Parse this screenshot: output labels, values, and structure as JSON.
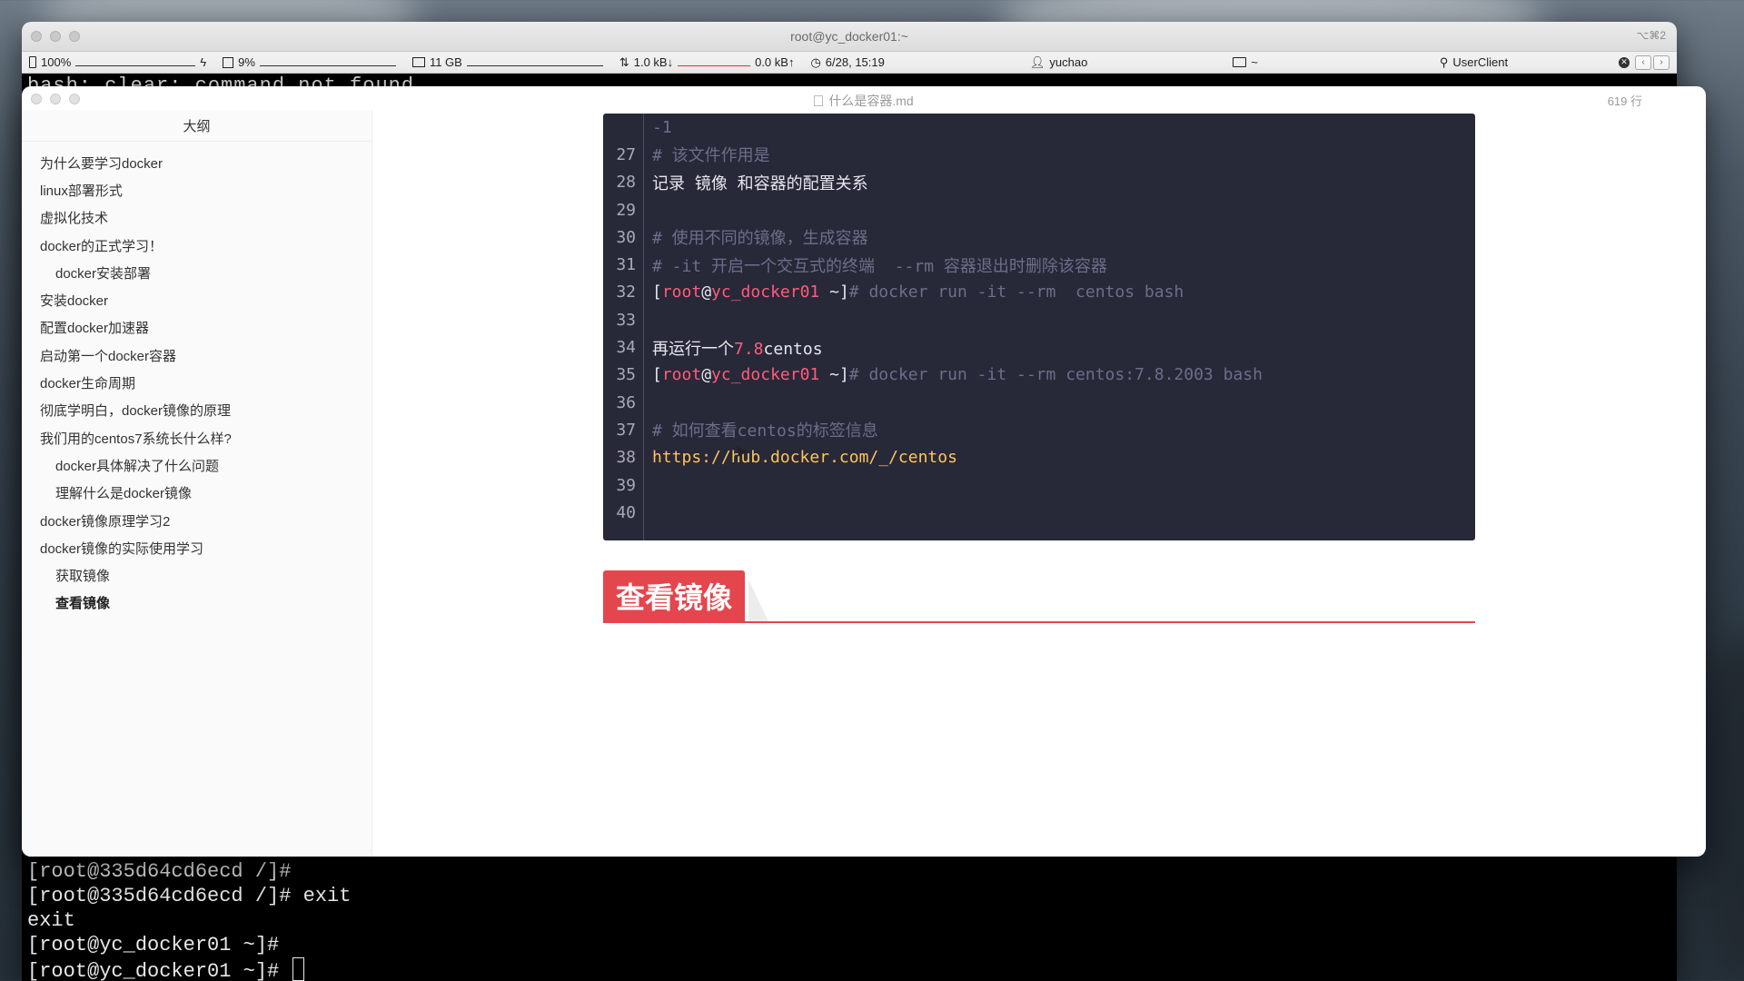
{
  "terminal": {
    "title": "root@yc_docker01:~",
    "shortcut": "⌥⌘2",
    "top_line": "bash: clear: command not found",
    "bottom_lines": [
      "[root@335d64cd6ecd /]#",
      "[root@335d64cd6ecd /]# exit",
      "exit",
      "[root@yc_docker01 ~]#",
      "[root@yc_docker01 ~]# "
    ]
  },
  "status_bar": {
    "battery": "100%",
    "cpu": "9%",
    "memory": "11 GB",
    "net_down": "1.0 kB↓",
    "net_up": "0.0 kB↑",
    "datetime": "6/28, 15:19",
    "user": "yuchao",
    "folder": "~",
    "search": "UserClient"
  },
  "editor": {
    "filename": "什么是容器.md",
    "line_count": "619 行",
    "outline_title": "大纲",
    "outline": [
      {
        "label": "为什么要学习docker",
        "level": 1
      },
      {
        "label": "linux部署形式",
        "level": 1
      },
      {
        "label": "虚拟化技术",
        "level": 1
      },
      {
        "label": "docker的正式学习！",
        "level": 1
      },
      {
        "label": "docker安装部署",
        "level": 2
      },
      {
        "label": "安装docker",
        "level": 1
      },
      {
        "label": "配置docker加速器",
        "level": 1
      },
      {
        "label": "启动第一个docker容器",
        "level": 1
      },
      {
        "label": "docker生命周期",
        "level": 1
      },
      {
        "label": "彻底学明白，docker镜像的原理",
        "level": 1
      },
      {
        "label": "我们用的centos7系统长什么样?",
        "level": 1
      },
      {
        "label": "docker具体解决了什么问题",
        "level": 2
      },
      {
        "label": "理解什么是docker镜像",
        "level": 2
      },
      {
        "label": "docker镜像原理学习2",
        "level": 1
      },
      {
        "label": "docker镜像的实际使用学习",
        "level": 1
      },
      {
        "label": "获取镜像",
        "level": 2
      },
      {
        "label": "查看镜像",
        "level": 2,
        "active": true
      }
    ],
    "code": {
      "partial_line": "-1",
      "lines": [
        {
          "n": "27",
          "segs": [
            {
              "t": "# 该文件作用是",
              "c": "com"
            }
          ]
        },
        {
          "n": "28",
          "segs": [
            {
              "t": "记录 镜像 和容器的配置关系",
              "c": "plain"
            }
          ]
        },
        {
          "n": "29",
          "segs": []
        },
        {
          "n": "30",
          "segs": [
            {
              "t": "# 使用不同的镜像，生成容器",
              "c": "com"
            }
          ]
        },
        {
          "n": "31",
          "segs": [
            {
              "t": "# -it 开启一个交互式的终端  --rm 容器退出时删除该容器",
              "c": "com"
            }
          ]
        },
        {
          "n": "32",
          "segs": [
            {
              "t": "[",
              "c": "plain"
            },
            {
              "t": "root",
              "c": "red"
            },
            {
              "t": "@",
              "c": "plain"
            },
            {
              "t": "yc_docker01",
              "c": "red"
            },
            {
              "t": " ~]",
              "c": "plain"
            },
            {
              "t": "# docker run -it --rm  centos bash",
              "c": "com"
            }
          ]
        },
        {
          "n": "33",
          "segs": []
        },
        {
          "n": "34",
          "segs": [
            {
              "t": "再运行一个",
              "c": "plain"
            },
            {
              "t": "7.8",
              "c": "red"
            },
            {
              "t": "centos",
              "c": "plain"
            }
          ]
        },
        {
          "n": "35",
          "segs": [
            {
              "t": "[",
              "c": "plain"
            },
            {
              "t": "root",
              "c": "red"
            },
            {
              "t": "@",
              "c": "plain"
            },
            {
              "t": "yc_docker01",
              "c": "red"
            },
            {
              "t": " ~]",
              "c": "plain"
            },
            {
              "t": "# docker run -it --rm centos:7.8.2003 bash",
              "c": "com"
            }
          ]
        },
        {
          "n": "36",
          "segs": []
        },
        {
          "n": "37",
          "segs": [
            {
              "t": "# 如何查看centos的标签信息",
              "c": "com"
            }
          ]
        },
        {
          "n": "38",
          "segs": [
            {
              "t": "https://hub.docker.com/_/centos",
              "c": "yellow"
            }
          ]
        },
        {
          "n": "39",
          "segs": []
        },
        {
          "n": "40",
          "segs": []
        }
      ]
    },
    "heading": "查看镜像"
  }
}
